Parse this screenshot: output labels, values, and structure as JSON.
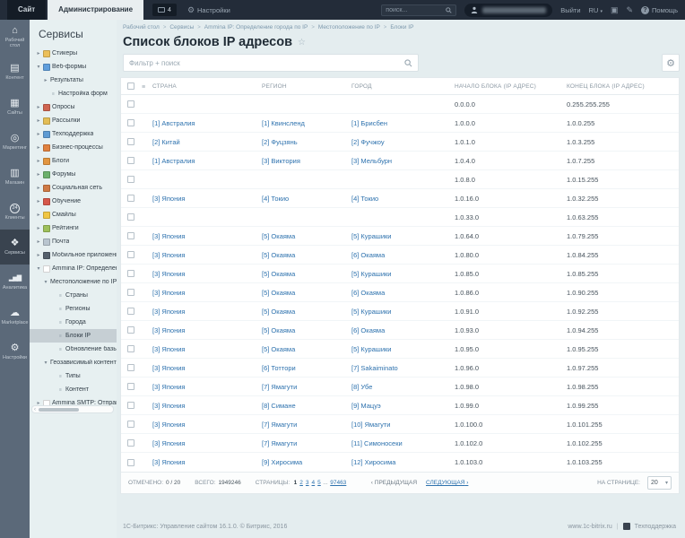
{
  "topbar": {
    "site_tab": "Сайт",
    "admin_tab": "Администрирование",
    "notifications_count": "4",
    "settings_label": "Настройки",
    "search_placeholder": "поиск...",
    "logout_label": "Выйти",
    "language_label": "RU",
    "help_label": "Помощь"
  },
  "rail": {
    "items": [
      {
        "id": "desktop",
        "label": "Рабочий стол",
        "icon": "home",
        "active": false
      },
      {
        "id": "content",
        "label": "Контент",
        "icon": "content",
        "active": false
      },
      {
        "id": "sites",
        "label": "Сайты",
        "icon": "sites",
        "active": false
      },
      {
        "id": "marketing",
        "label": "Маркетинг",
        "icon": "marketing",
        "active": false
      },
      {
        "id": "shop",
        "label": "Магазин",
        "icon": "shop",
        "active": false
      },
      {
        "id": "clients",
        "label": "Клиенты",
        "icon": "clients",
        "active": false
      },
      {
        "id": "services",
        "label": "Сервисы",
        "icon": "services",
        "active": true
      },
      {
        "id": "analytics",
        "label": "Аналитика",
        "icon": "analytics",
        "active": false
      },
      {
        "id": "marketplace",
        "label": "Marketplace",
        "icon": "marketplace",
        "active": false
      },
      {
        "id": "settings",
        "label": "Настройки",
        "icon": "settings",
        "active": false
      }
    ]
  },
  "sidebar": {
    "title": "Сервисы",
    "items": [
      {
        "id": "stickers",
        "label": "Стикеры",
        "level": 0,
        "arrow": "r",
        "icon": "folder",
        "color": "#ecc05a"
      },
      {
        "id": "webforms",
        "label": "Веб-формы",
        "level": 0,
        "arrow": "d",
        "icon": "webform",
        "color": "#5f9edc"
      },
      {
        "id": "results",
        "label": "Результаты",
        "level": 1,
        "arrow": "r"
      },
      {
        "id": "form-settings",
        "label": "Настройка форм",
        "level": 1,
        "bullet": true
      },
      {
        "id": "polls",
        "label": "Опросы",
        "level": 0,
        "arrow": "r",
        "icon": "pie",
        "color": "#cf6450"
      },
      {
        "id": "newsletters",
        "label": "Рассылки",
        "level": 0,
        "arrow": "r",
        "icon": "mail",
        "color": "#e3bd55"
      },
      {
        "id": "helpdesk",
        "label": "Техподдержка",
        "level": 0,
        "arrow": "r",
        "icon": "headset",
        "color": "#5e9bd3"
      },
      {
        "id": "bizproc",
        "label": "Бизнес-процессы",
        "level": 0,
        "arrow": "r",
        "icon": "process",
        "color": "#e0813f"
      },
      {
        "id": "blogs",
        "label": "Блоги",
        "level": 0,
        "arrow": "r",
        "icon": "blog",
        "color": "#e2953f"
      },
      {
        "id": "forums",
        "label": "Форумы",
        "level": 0,
        "arrow": "r",
        "icon": "chat",
        "color": "#6cb06c"
      },
      {
        "id": "social",
        "label": "Социальная сеть",
        "level": 0,
        "arrow": "r",
        "icon": "people",
        "color": "#cf7a45"
      },
      {
        "id": "learning",
        "label": "Обучение",
        "level": 0,
        "arrow": "r",
        "icon": "book",
        "color": "#d6574a"
      },
      {
        "id": "smiles",
        "label": "Смайлы",
        "level": 0,
        "arrow": "r",
        "icon": "smiley",
        "color": "#f0c643"
      },
      {
        "id": "ratings",
        "label": "Рейтинги",
        "level": 0,
        "arrow": "r",
        "icon": "star",
        "color": "#9ec05a"
      },
      {
        "id": "mail",
        "label": "Почта",
        "level": 0,
        "arrow": "r",
        "icon": "envelope",
        "color": "#b9c5cf"
      },
      {
        "id": "mobile",
        "label": "Мобильное приложение",
        "level": 0,
        "arrow": "r",
        "icon": "phone",
        "color": "#55606c"
      },
      {
        "id": "ammina-ip",
        "label": "Ammina IP: Определение г",
        "level": 0,
        "arrow": "d",
        "icon": "page",
        "color": "#ffffff"
      },
      {
        "id": "ip-location",
        "label": "Местоположение по IP",
        "level": 1,
        "arrow": "d"
      },
      {
        "id": "countries",
        "label": "Страны",
        "level": 2,
        "bullet": true
      },
      {
        "id": "regions",
        "label": "Регионы",
        "level": 2,
        "bullet": true
      },
      {
        "id": "cities",
        "label": "Города",
        "level": 2,
        "bullet": true
      },
      {
        "id": "ip-blocks",
        "label": "Блоки IP",
        "level": 2,
        "bullet": true,
        "selected": true
      },
      {
        "id": "db-update",
        "label": "Обновление базы",
        "level": 2,
        "bullet": true
      },
      {
        "id": "geo-content",
        "label": "Геозависимый контент",
        "level": 1,
        "arrow": "d"
      },
      {
        "id": "geo-types",
        "label": "Типы",
        "level": 2,
        "bullet": true
      },
      {
        "id": "geo-content-items",
        "label": "Контент",
        "level": 2,
        "bullet": true
      },
      {
        "id": "ammina-smtp",
        "label": "Ammina SMTP: Отправка п",
        "level": 0,
        "arrow": "r",
        "icon": "page",
        "color": "#ffffff"
      }
    ]
  },
  "breadcrumb": {
    "items": [
      "Рабочий стол",
      "Сервисы",
      "Ammina IP: Определение города по IP",
      "Местоположение по IP",
      "Блоки IP"
    ]
  },
  "page": {
    "title": "Список блоков IP адресов"
  },
  "filter": {
    "placeholder": "Фильтр + поиск"
  },
  "table": {
    "columns": [
      "СТРАНА",
      "РЕГИОН",
      "ГОРОД",
      "НАЧАЛО БЛОКА (IP АДРЕС)",
      "КОНЕЦ БЛОКА (IP АДРЕС)"
    ],
    "rows": [
      {
        "country": "",
        "region": "",
        "city": "",
        "start": "0.0.0.0",
        "end": "0.255.255.255"
      },
      {
        "country": "[1] Австралия",
        "region": "[1] Квинсленд",
        "city": "[1] Брисбен",
        "start": "1.0.0.0",
        "end": "1.0.0.255"
      },
      {
        "country": "[2] Китай",
        "region": "[2] Фуцзянь",
        "city": "[2] Фучжоу",
        "start": "1.0.1.0",
        "end": "1.0.3.255"
      },
      {
        "country": "[1] Австралия",
        "region": "[3] Виктория",
        "city": "[3] Мельбурн",
        "start": "1.0.4.0",
        "end": "1.0.7.255"
      },
      {
        "country": "",
        "region": "",
        "city": "",
        "start": "1.0.8.0",
        "end": "1.0.15.255"
      },
      {
        "country": "[3] Япония",
        "region": "[4] Токио",
        "city": "[4] Токио",
        "start": "1.0.16.0",
        "end": "1.0.32.255"
      },
      {
        "country": "",
        "region": "",
        "city": "",
        "start": "1.0.33.0",
        "end": "1.0.63.255"
      },
      {
        "country": "[3] Япония",
        "region": "[5] Окаяма",
        "city": "[5] Курашики",
        "start": "1.0.64.0",
        "end": "1.0.79.255"
      },
      {
        "country": "[3] Япония",
        "region": "[5] Окаяма",
        "city": "[6] Окаяма",
        "start": "1.0.80.0",
        "end": "1.0.84.255"
      },
      {
        "country": "[3] Япония",
        "region": "[5] Окаяма",
        "city": "[5] Курашики",
        "start": "1.0.85.0",
        "end": "1.0.85.255"
      },
      {
        "country": "[3] Япония",
        "region": "[5] Окаяма",
        "city": "[6] Окаяма",
        "start": "1.0.86.0",
        "end": "1.0.90.255"
      },
      {
        "country": "[3] Япония",
        "region": "[5] Окаяма",
        "city": "[5] Курашики",
        "start": "1.0.91.0",
        "end": "1.0.92.255"
      },
      {
        "country": "[3] Япония",
        "region": "[5] Окаяма",
        "city": "[6] Окаяма",
        "start": "1.0.93.0",
        "end": "1.0.94.255"
      },
      {
        "country": "[3] Япония",
        "region": "[5] Окаяма",
        "city": "[5] Курашики",
        "start": "1.0.95.0",
        "end": "1.0.95.255"
      },
      {
        "country": "[3] Япония",
        "region": "[6] Тоттори",
        "city": "[7] Sakaiminato",
        "start": "1.0.96.0",
        "end": "1.0.97.255"
      },
      {
        "country": "[3] Япония",
        "region": "[7] Ямагути",
        "city": "[8] Убе",
        "start": "1.0.98.0",
        "end": "1.0.98.255"
      },
      {
        "country": "[3] Япония",
        "region": "[8] Симане",
        "city": "[9] Мацуэ",
        "start": "1.0.99.0",
        "end": "1.0.99.255"
      },
      {
        "country": "[3] Япония",
        "region": "[7] Ямагути",
        "city": "[10] Ямагути",
        "start": "1.0.100.0",
        "end": "1.0.101.255"
      },
      {
        "country": "[3] Япония",
        "region": "[7] Ямагути",
        "city": "[11] Симоносеки",
        "start": "1.0.102.0",
        "end": "1.0.102.255"
      },
      {
        "country": "[3] Япония",
        "region": "[9] Хиросима",
        "city": "[12] Хиросима",
        "start": "1.0.103.0",
        "end": "1.0.103.255"
      }
    ]
  },
  "pagination": {
    "checked_label": "ОТМЕЧЕНО:",
    "checked_value": "0 / 20",
    "total_label": "ВСЕГО:",
    "total_value": "1949246",
    "pages_label": "СТРАНИЦЫ:",
    "pages": [
      "1",
      "2",
      "3",
      "4",
      "5"
    ],
    "current_page": "1",
    "ellipsis": "...",
    "last_page": "97463",
    "prev_label": "ПРЕДЫДУЩАЯ",
    "next_label": "СЛЕДУЮЩАЯ",
    "per_page_label": "НА СТРАНИЦЕ:",
    "per_page_value": "20"
  },
  "footer": {
    "copyright": "1С-Битрикс: Управление сайтом 16.1.0. © Битрикс, 2016",
    "site_link": "www.1c-bitrix.ru",
    "support_label": "Техподдержка"
  },
  "colors": {
    "link": "#2e72ae",
    "topbar_bg": "#232c39",
    "rail_bg": "#5b6979",
    "rail_active_bg": "#39434f",
    "sidebar_bg": "#e7f0f1",
    "selected_item_bg": "#c6cfd4",
    "content_bg": "#e4edef"
  }
}
